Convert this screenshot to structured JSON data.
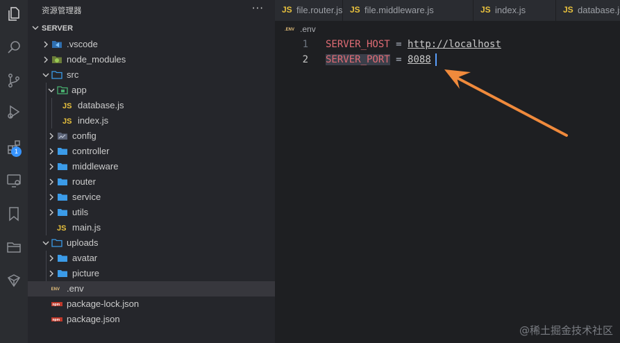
{
  "activity_bar": {
    "items": [
      "explorer-icon",
      "search-icon",
      "source-control-icon",
      "run-debug-icon",
      "extensions-icon",
      "remote-explorer-icon",
      "bookmarks-icon",
      "folder-icon",
      "git-graph-icon"
    ],
    "extensions_badge": "1"
  },
  "sidebar": {
    "title": "资源管理器",
    "more": "···",
    "folder": "SERVER",
    "items": [
      {
        "label": ".vscode",
        "icon": "vscode-folder-icon"
      },
      {
        "label": "node_modules",
        "icon": "node-folder-icon"
      },
      {
        "label": "src",
        "icon": "folder-open-icon"
      },
      {
        "label": "app",
        "icon": "app-folder-icon"
      },
      {
        "label": "database.js",
        "icon": "js-icon"
      },
      {
        "label": "index.js",
        "icon": "js-icon"
      },
      {
        "label": "config",
        "icon": "config-folder-icon"
      },
      {
        "label": "controller",
        "icon": "folder-icon"
      },
      {
        "label": "middleware",
        "icon": "folder-icon"
      },
      {
        "label": "router",
        "icon": "folder-icon"
      },
      {
        "label": "service",
        "icon": "folder-icon"
      },
      {
        "label": "utils",
        "icon": "folder-icon"
      },
      {
        "label": "main.js",
        "icon": "js-icon"
      },
      {
        "label": "uploads",
        "icon": "folder-open-icon"
      },
      {
        "label": "avatar",
        "icon": "folder-icon"
      },
      {
        "label": "picture",
        "icon": "folder-icon"
      },
      {
        "label": ".env",
        "icon": "env-icon"
      },
      {
        "label": "package-lock.json",
        "icon": "npm-icon"
      },
      {
        "label": "package.json",
        "icon": "npm-icon"
      }
    ]
  },
  "tabs": [
    {
      "label": "file.router.js",
      "icon_text": "JS"
    },
    {
      "label": "file.middleware.js",
      "icon_text": "JS"
    },
    {
      "label": "index.js",
      "icon_text": "JS"
    },
    {
      "label": "database.js",
      "icon_text": "JS"
    }
  ],
  "editor": {
    "breadcrumb_icon": ".ENV",
    "breadcrumb": ".env",
    "lines": [
      {
        "number": "1",
        "key": "SERVER_HOST",
        "op": "=",
        "value": "http://localhost"
      },
      {
        "number": "2",
        "key": "SERVER_PORT",
        "op": "=",
        "value": "8088"
      }
    ]
  },
  "watermark": "@稀土掘金技术社区",
  "colors": {
    "accent": "#3794ff",
    "env_key": "#e06c75",
    "js_badge": "#e8c13d",
    "folder_blue": "#3b9be8",
    "arrow": "#f08a3c"
  }
}
